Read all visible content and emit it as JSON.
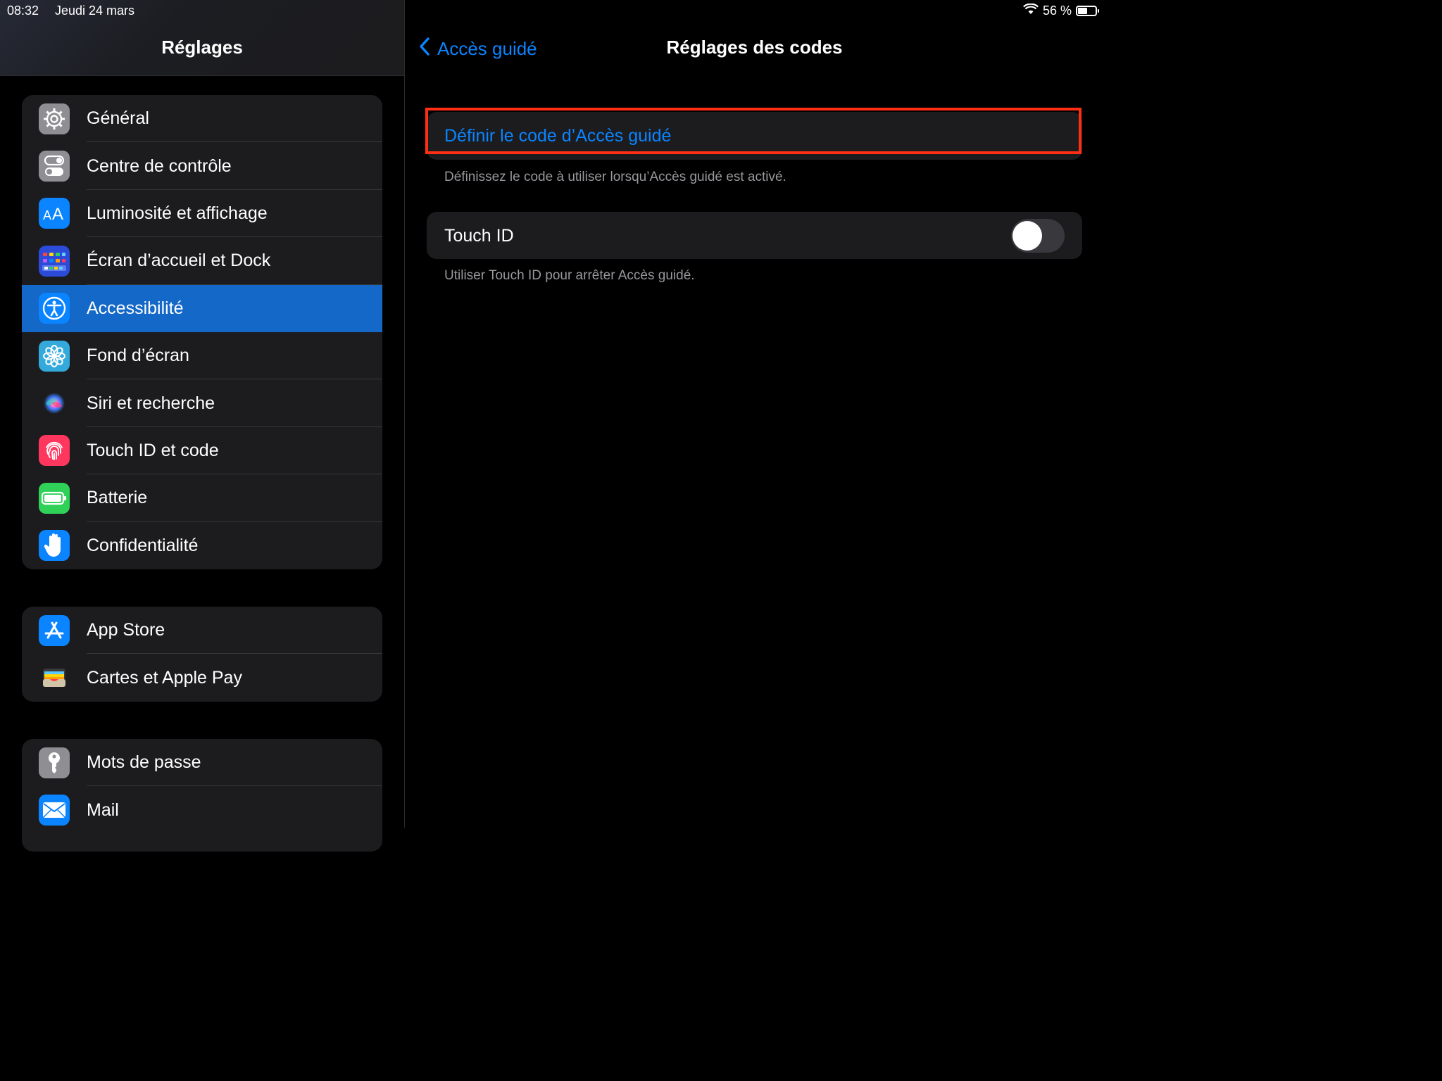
{
  "status_bar": {
    "time": "08:32",
    "date": "Jeudi 24 mars",
    "battery_text": "56 %",
    "battery_level": 0.56
  },
  "sidebar": {
    "title": "Réglages",
    "groups": [
      {
        "items": [
          {
            "label": "Général",
            "icon": "gear-icon",
            "color": "#8e8e93"
          },
          {
            "label": "Centre de contrôle",
            "icon": "switches-icon",
            "color": "#8e8e93"
          },
          {
            "label": "Luminosité et affichage",
            "icon": "text-size-icon",
            "color": "#0a84ff"
          },
          {
            "label": "Écran d’accueil et Dock",
            "icon": "home-grid-icon",
            "color": "#2c4bd9"
          },
          {
            "label": "Accessibilité",
            "icon": "accessibility-icon",
            "color": "#0a84ff",
            "selected": true
          },
          {
            "label": "Fond d’écran",
            "icon": "flower-icon",
            "color": "#34aadc"
          },
          {
            "label": "Siri et recherche",
            "icon": "siri-icon",
            "color": "#1c1c1e"
          },
          {
            "label": "Touch ID et code",
            "icon": "fingerprint-icon",
            "color": "#ff375f"
          },
          {
            "label": "Batterie",
            "icon": "battery-icon",
            "color": "#30d158"
          },
          {
            "label": "Confidentialité",
            "icon": "hand-icon",
            "color": "#0a84ff"
          }
        ]
      },
      {
        "items": [
          {
            "label": "App Store",
            "icon": "app-store-icon",
            "color": "#0a84ff"
          },
          {
            "label": "Cartes et Apple Pay",
            "icon": "wallet-icon",
            "color": "#1c1c1e"
          }
        ]
      },
      {
        "items": [
          {
            "label": "Mots de passe",
            "icon": "key-icon",
            "color": "#8e8e93"
          },
          {
            "label": "Mail",
            "icon": "mail-icon",
            "color": "#0a84ff"
          }
        ]
      }
    ]
  },
  "detail": {
    "back_label": "Accès guidé",
    "title": "Réglages des codes",
    "set_code_label": "Définir le code d’Accès guidé",
    "set_code_footer": "Définissez le code à utiliser lorsqu’Accès guidé est activé.",
    "touch_id_label": "Touch ID",
    "touch_id_enabled": false,
    "touch_id_footer": "Utiliser Touch ID pour arrêter Accès guidé."
  }
}
